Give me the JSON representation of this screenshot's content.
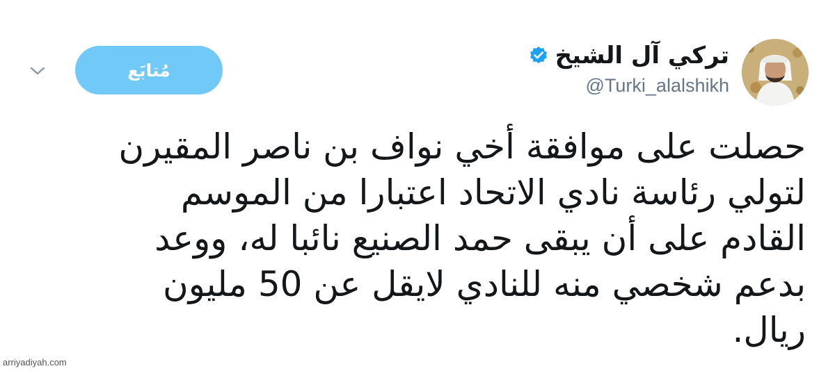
{
  "author": {
    "display_name": "تركي آل الشيخ",
    "handle": "@Turki_alalshikh",
    "verified_icon": "verified-badge-icon"
  },
  "actions": {
    "follow_label": "مُتابَع",
    "menu_icon": "chevron-down-icon"
  },
  "tweet": {
    "lines": [
      "حصلت على موافقة أخي نواف بن ناصر المقيرن",
      "لتولي رئاسة نادي الاتحاد اعتبارا من الموسم",
      "القادم على أن يبقى حمد الصنيع نائبا له، ووعد",
      "بدعم شخصي منه للنادي لايقل عن 50 مليون",
      "ريال."
    ]
  },
  "watermark": "arriyadiyah.com",
  "colors": {
    "follow_button": "#71c9f8",
    "verified_badge": "#1da1f2",
    "handle_text": "#657786",
    "body_text": "#14171a"
  }
}
